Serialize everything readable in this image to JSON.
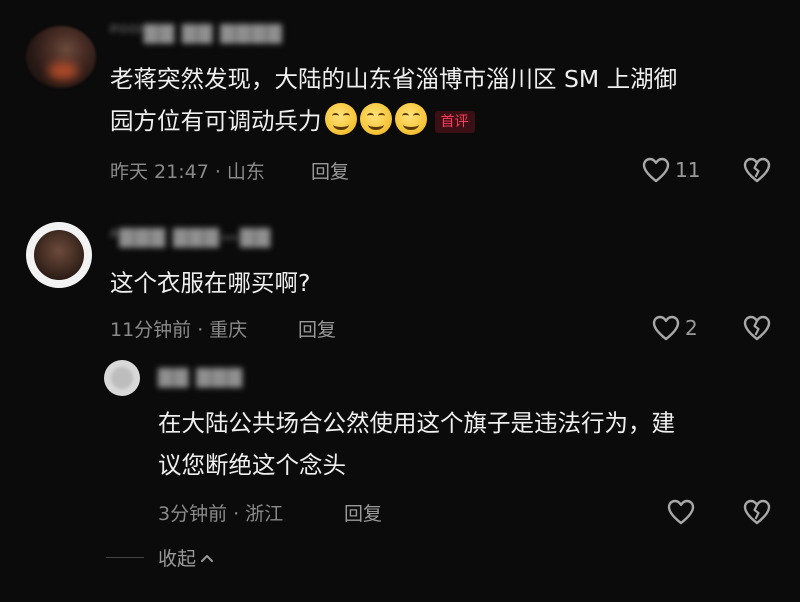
{
  "comments": [
    {
      "username": "ᴾᴼᴼᴵ▇▇ ▇▇ ▇▇▇▇",
      "text_line1": "老蒋突然发现，大陆的山东省淄博市淄川区 SM 上湖御",
      "text_line2": "园方位有可调动兵力",
      "emojis": [
        "grinning-face",
        "grinning-face",
        "grinning-face"
      ],
      "badge": "首评",
      "time_location": "昨天 21:47 · 山东",
      "reply_label": "回复",
      "likes": "11"
    },
    {
      "username": "ᴬ▇▇▇ ▇▇▇—▇▇",
      "text_line1": "这个衣服在哪买啊?",
      "time_location": "11分钟前 · 重庆",
      "reply_label": "回复",
      "likes": "2"
    },
    {
      "username": "▇▇ ▇▇▇",
      "text_line1": "在大陆公共场合公然使用这个旗子是违法行为，建",
      "text_line2": "议您断绝这个念头",
      "time_location": "3分钟前 · 浙江",
      "reply_label": "回复",
      "likes": ""
    }
  ],
  "collapse_label": "收起",
  "colors": {
    "background": "#0b0b0b",
    "text": "#efefef",
    "meta": "#8a8a8a",
    "badge_text": "#ff3b5c"
  }
}
